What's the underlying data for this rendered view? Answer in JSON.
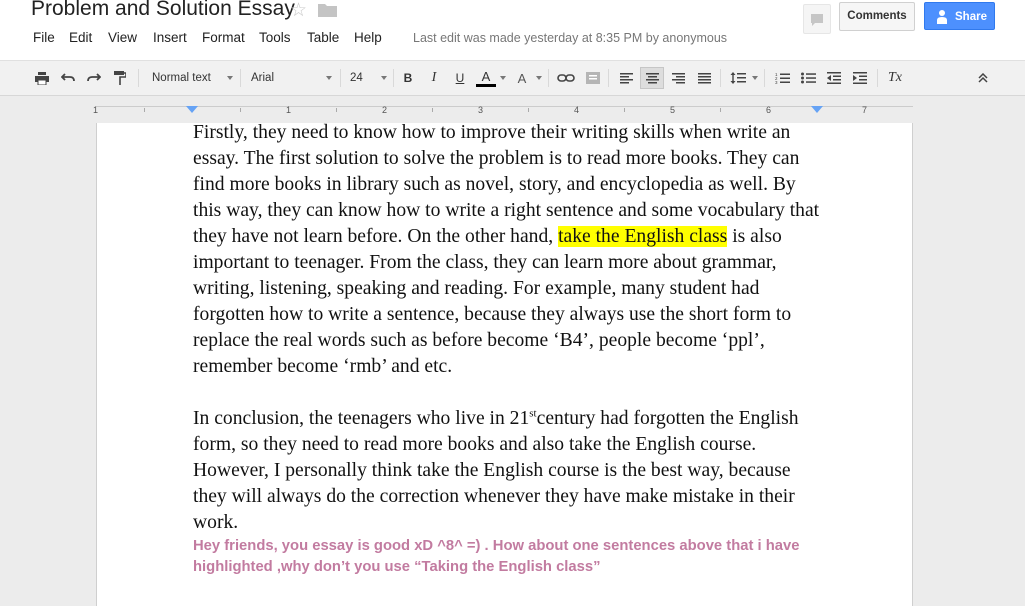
{
  "header": {
    "title": "Problem and Solution Essay",
    "last_edit": "Last edit was made yesterday at 8:35 PM by anonymous",
    "comments_label": "Comments",
    "share_label": "Share"
  },
  "menu": [
    "File",
    "Edit",
    "View",
    "Insert",
    "Format",
    "Tools",
    "Table",
    "Help"
  ],
  "toolbar": {
    "style": "Normal text",
    "font": "Arial",
    "size": "24",
    "bold": "B",
    "italic": "I",
    "underline": "U",
    "text_color_letter": "A",
    "highlight_letter": "A",
    "clear_format": "Tx"
  },
  "ruler": {
    "numbers": [
      "1",
      "1",
      "2",
      "3",
      "4",
      "5",
      "6",
      "7"
    ]
  },
  "doc": {
    "para1_a": "Firstly, they need to know how to improve their writing skills when write an essay. The first solution to solve the problem is to read more books. They can find more books in library such as novel, story, and encyclopedia as well. By this way, they can know how to write a right sentence and some vocabulary that they have not learn before. On the other hand,",
    "para1_hl": "take the English class",
    "para1_b": "is also important to teenager. From the class, they can learn more about grammar, writing, listening, speaking and reading. For example, many student had forgotten how to write a sentence, because they always use the short form to replace the real words such as before become ‘B4’, people become ‘ppl’, remember become ‘rmb’ and etc.",
    "para2_a": "In conclusion, the teenagers who live in 21",
    "para2_sup": "st",
    "para2_b": "century had forgotten the English form, so they need to read more books and also take the English course. However, I personally think take the English course is the best way, because they will always do the correction whenever they have make mistake in their work.",
    "comment": "Hey friends, you essay is good  xD  ^8^  =)  . How about one sentences above that i have highlighted ,why don’t you use “Taking the English class”"
  },
  "colors": {
    "highlight": "#ffff00",
    "comment": "#c27ba0",
    "share_button": "#4d90fe",
    "indent_marker": "#66a3f5"
  }
}
